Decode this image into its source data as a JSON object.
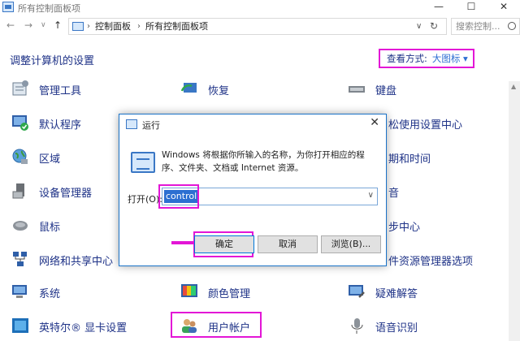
{
  "window": {
    "title": "所有控制面板项",
    "minimize": "—",
    "maximize": "☐",
    "close": "✕"
  },
  "address": {
    "back": "←",
    "forward": "→",
    "dropdown": "∨",
    "up": "↑",
    "segments": [
      "控制面板",
      "所有控制面板项"
    ],
    "refresh": "↻",
    "dropdown2": "∨"
  },
  "search": {
    "placeholder": "搜索控制..."
  },
  "header": {
    "title": "调整计算机的设置",
    "view_label": "查看方式:",
    "view_value": "大图标 ▾"
  },
  "items": {
    "c1": [
      "管理工具",
      "默认程序",
      "区域",
      "设备管理器",
      "鼠标",
      "网络和共享中心",
      "系统",
      "英特尔® 显卡设置"
    ],
    "c2": [
      "恢复",
      "颜色管理",
      "用户帐户"
    ],
    "c3": [
      "键盘",
      "松使用设置中心",
      "期和时间",
      "音",
      "步中心",
      "件资源管理器选项",
      "疑难解答",
      "语音识别"
    ]
  },
  "dialog": {
    "title": "运行",
    "close": "✕",
    "description": "Windows 将根据你所输入的名称，为你打开相应的程序、文件夹、文档或 Internet 资源。",
    "open_label": "打开(O):",
    "open_value": "control",
    "ok": "确定",
    "cancel": "取消",
    "browse": "浏览(B)..."
  },
  "colors": {
    "highlight": "#e316d6",
    "link": "#1e3287",
    "selection": "#2c6fd1"
  }
}
